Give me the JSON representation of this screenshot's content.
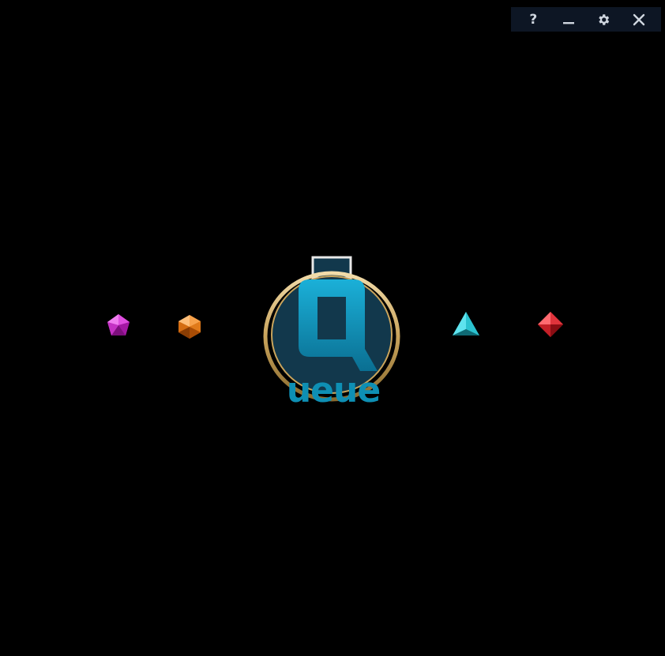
{
  "window_controls": [
    {
      "name": "help-button",
      "icon": "question-mark-icon",
      "glyph": "?"
    },
    {
      "name": "minimize-button",
      "icon": "minimize-icon"
    },
    {
      "name": "settings-button",
      "icon": "gear-icon"
    },
    {
      "name": "close-button",
      "icon": "close-icon"
    }
  ],
  "logo": {
    "text": "ueue",
    "letter": "Q",
    "colors": {
      "primary": "#0e8fb4",
      "ring": "#c9a45c",
      "dark": "#12384c"
    }
  },
  "gems": [
    {
      "name": "pink-gem",
      "color": "#d13fd1",
      "icon": "pentagon-gem-icon"
    },
    {
      "name": "orange-gem",
      "color": "#e07a1a",
      "icon": "hexagon-gem-icon"
    },
    {
      "name": "teal-gem",
      "color": "#2bc2cf",
      "icon": "triangle-gem-icon"
    },
    {
      "name": "red-gem",
      "color": "#d9262f",
      "icon": "diamond-gem-icon"
    }
  ],
  "colors": {
    "background": "#000000",
    "control_bar": "#0d1624",
    "control_icon": "#cfd6df"
  }
}
